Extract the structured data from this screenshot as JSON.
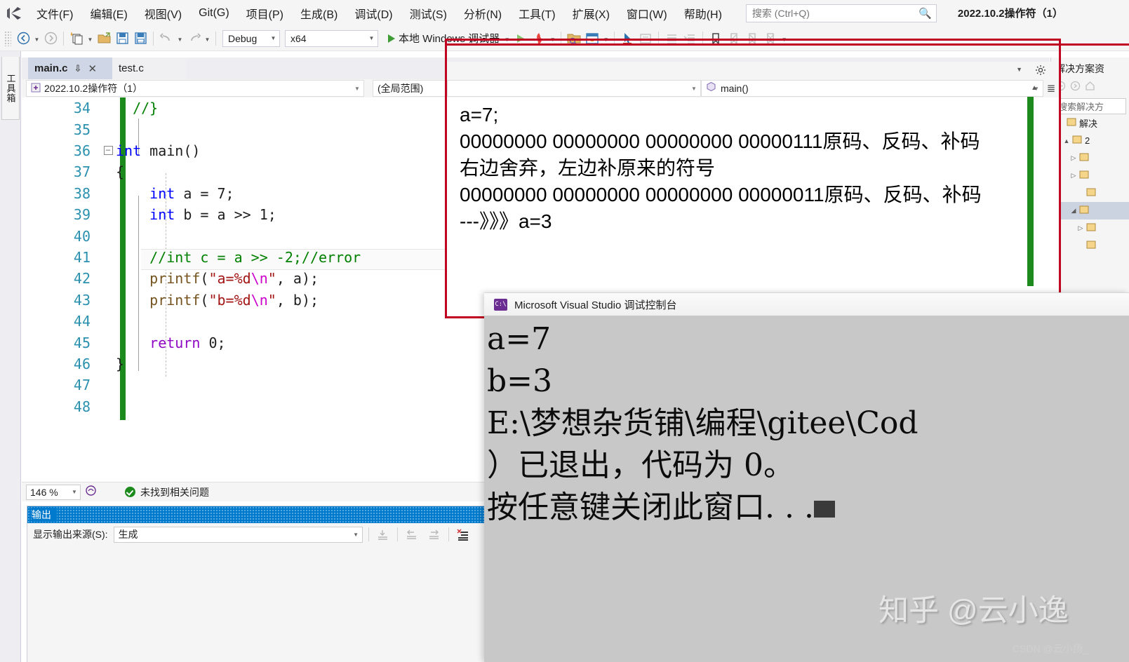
{
  "menu": {
    "logo_name": "visual-studio-logo",
    "items": [
      {
        "label": "文件(F)"
      },
      {
        "label": "编辑(E)"
      },
      {
        "label": "视图(V)"
      },
      {
        "label": "Git(G)"
      },
      {
        "label": "项目(P)"
      },
      {
        "label": "生成(B)"
      },
      {
        "label": "调试(D)"
      },
      {
        "label": "测试(S)"
      },
      {
        "label": "分析(N)"
      },
      {
        "label": "工具(T)"
      },
      {
        "label": "扩展(X)"
      },
      {
        "label": "窗口(W)"
      },
      {
        "label": "帮助(H)"
      }
    ],
    "search_placeholder": "搜索 (Ctrl+Q)",
    "search_value": "",
    "window_title": "2022.10.2操作符（1）"
  },
  "toolbar": {
    "back_label": "◀",
    "forward_label": "▶",
    "config_value": "Debug",
    "platform_value": "x64",
    "run_label": "本地 Windows 调试器"
  },
  "left_rail": {
    "toolbox_label": "工具箱"
  },
  "tabs": [
    {
      "label": "main.c",
      "active": true,
      "pin": "📌",
      "close": "✕"
    },
    {
      "label": "test.c",
      "active": false
    }
  ],
  "navbars": {
    "project_scope": "2022.10.2操作符（1）",
    "global_scope": "(全局范围)",
    "member_scope": "main()"
  },
  "editor": {
    "zoom_level": "146 %",
    "issue_status": "未找到相关问题",
    "lines": [
      {
        "num": "34",
        "fold": "",
        "tokens": [
          {
            "t": "  //}",
            "c": "c-cm"
          }
        ]
      },
      {
        "num": "35",
        "fold": "",
        "tokens": []
      },
      {
        "num": "36",
        "fold": "-",
        "tokens": [
          {
            "t": "int",
            "c": "c-kw"
          },
          {
            "t": " main()",
            "c": "c-num"
          }
        ]
      },
      {
        "num": "37",
        "fold": "",
        "tokens": [
          {
            "t": "{",
            "c": "c-num"
          }
        ]
      },
      {
        "num": "38",
        "fold": "",
        "tokens": [
          {
            "t": "    ",
            "c": ""
          },
          {
            "t": "int",
            "c": "c-kw"
          },
          {
            "t": " a = 7;",
            "c": "c-num"
          }
        ]
      },
      {
        "num": "39",
        "fold": "",
        "tokens": [
          {
            "t": "    ",
            "c": ""
          },
          {
            "t": "int",
            "c": "c-kw"
          },
          {
            "t": " b = a >> 1;",
            "c": "c-num"
          }
        ]
      },
      {
        "num": "40",
        "fold": "",
        "tokens": []
      },
      {
        "num": "41",
        "fold": "",
        "tokens": [
          {
            "t": "    //int c = a >> -2;//error",
            "c": "c-cm"
          }
        ]
      },
      {
        "num": "42",
        "fold": "",
        "tokens": [
          {
            "t": "    ",
            "c": ""
          },
          {
            "t": "printf",
            "c": "c-fn"
          },
          {
            "t": "(",
            "c": "c-num"
          },
          {
            "t": "\"a=%d",
            "c": "c-st"
          },
          {
            "t": "\\n",
            "c": "c-es"
          },
          {
            "t": "\"",
            "c": "c-st"
          },
          {
            "t": ", a);",
            "c": "c-num"
          }
        ]
      },
      {
        "num": "43",
        "fold": "",
        "tokens": [
          {
            "t": "    ",
            "c": ""
          },
          {
            "t": "printf",
            "c": "c-fn"
          },
          {
            "t": "(",
            "c": "c-num"
          },
          {
            "t": "\"b=%d",
            "c": "c-st"
          },
          {
            "t": "\\n",
            "c": "c-es"
          },
          {
            "t": "\"",
            "c": "c-st"
          },
          {
            "t": ", b);",
            "c": "c-num"
          }
        ]
      },
      {
        "num": "44",
        "fold": "",
        "tokens": []
      },
      {
        "num": "45",
        "fold": "",
        "tokens": [
          {
            "t": "    ",
            "c": ""
          },
          {
            "t": "return",
            "c": "c-ret"
          },
          {
            "t": " 0;",
            "c": "c-num"
          }
        ]
      },
      {
        "num": "46",
        "fold": "",
        "tokens": [
          {
            "t": "}",
            "c": "c-num"
          }
        ]
      },
      {
        "num": "47",
        "fold": "",
        "tokens": []
      },
      {
        "num": "48",
        "fold": "",
        "tokens": []
      }
    ]
  },
  "note_overlay": {
    "member_scope": "main()",
    "lines": [
      "a=7;",
      "00000000 00000000 00000000 00000111原码、反码、补码",
      "右边舍弃，左边补原来的符号",
      "00000000 00000000 00000000 00000011原码、反码、补码",
      "---》》》a=3"
    ]
  },
  "output_pane": {
    "title": "输出",
    "source_label": "显示输出来源(S):",
    "source_value": "生成"
  },
  "solution_explorer": {
    "title": "解决方案资",
    "search_placeholder": "搜索解决方",
    "rows": [
      {
        "label": "解决",
        "arrow": "",
        "indent": 6,
        "selected": false
      },
      {
        "label": "2",
        "arrow": "▲",
        "indent": 14,
        "selected": false
      },
      {
        "label": "",
        "arrow": "▷",
        "indent": 24,
        "selected": false
      },
      {
        "label": "",
        "arrow": "▷",
        "indent": 24,
        "selected": false
      },
      {
        "label": "",
        "arrow": "",
        "indent": 34,
        "selected": false
      },
      {
        "label": "",
        "arrow": "◢",
        "indent": 24,
        "selected": true
      },
      {
        "label": "",
        "arrow": "▷",
        "indent": 34,
        "selected": false
      },
      {
        "label": "",
        "arrow": "",
        "indent": 34,
        "selected": false
      }
    ]
  },
  "console": {
    "title": "Microsoft Visual Studio 调试控制台",
    "icon_label": "C:\\",
    "lines": [
      "a=7",
      "b=3",
      "",
      "E:\\梦想杂货铺\\编程\\gitee\\Cod",
      "）已退出，代码为 0。",
      "按任意键关闭此窗口. . ."
    ]
  },
  "watermark": {
    "zhihu": "知乎 @云小逸",
    "csdn": "CSDN @云小扬_"
  }
}
